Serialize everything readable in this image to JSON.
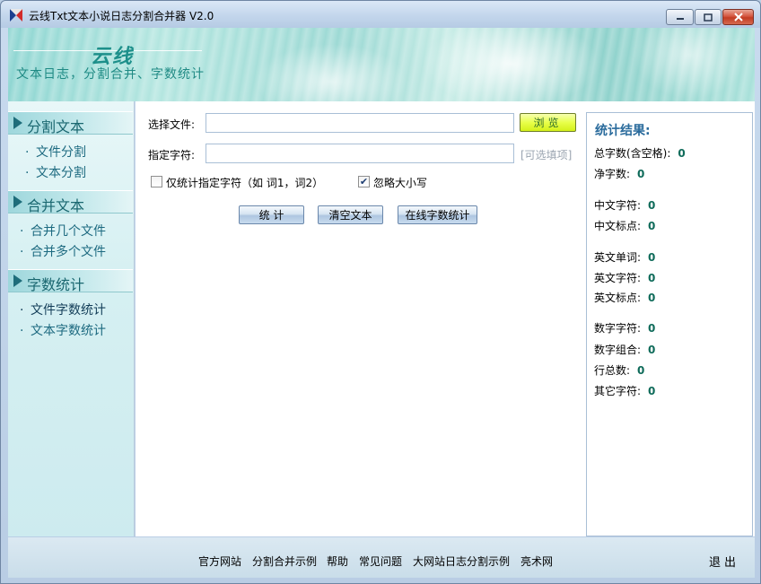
{
  "window": {
    "title": "云线Txt文本小说日志分割合并器 V2.0",
    "min_symbol": "▁",
    "max_symbol": "▢",
    "close_symbol": "✕"
  },
  "banner": {
    "brand": "云线",
    "slogan": "文本日志，分割合并、字数统计"
  },
  "sidebar": {
    "sections": [
      {
        "title": "分割文本",
        "items": [
          "文件分割",
          "文本分割"
        ]
      },
      {
        "title": "合并文本",
        "items": [
          "合并几个文件",
          "合并多个文件"
        ]
      },
      {
        "title": "字数统计",
        "items": [
          "文件字数统计",
          "文本字数统计"
        ]
      }
    ],
    "dot": "·"
  },
  "form": {
    "file_label": "选择文件:",
    "file_value": "",
    "browse_label": "浏览",
    "chars_label": "指定字符:",
    "chars_value": "",
    "chars_hint": "[可选填项]",
    "only_specified_label": "仅统计指定字符（如 词1，词2）",
    "only_specified_checked": false,
    "ignore_case_label": "忽略大小写",
    "ignore_case_checked": true,
    "check_mark": "✔",
    "btn_count": "统 计",
    "btn_clear": "清空文本",
    "btn_online": "在线字数统计"
  },
  "results": {
    "title": "统计结果:",
    "stats": [
      {
        "label": "总字数(含空格):",
        "value": "0"
      },
      {
        "label": "净字数:",
        "value": "0"
      },
      {
        "label": "中文字符:",
        "value": "0"
      },
      {
        "label": "中文标点:",
        "value": "0"
      },
      {
        "label": "英文单词:",
        "value": "0"
      },
      {
        "label": "英文字符:",
        "value": "0"
      },
      {
        "label": "英文标点:",
        "value": "0"
      },
      {
        "label": "数字字符:",
        "value": "0"
      },
      {
        "label": "数字组合:",
        "value": "0"
      },
      {
        "label": "行总数:",
        "value": "0"
      },
      {
        "label": "其它字符:",
        "value": "0"
      }
    ]
  },
  "footer": {
    "links": [
      "官方网站",
      "分割合并示例",
      "帮助",
      "常见问题",
      "大网站日志分割示例",
      "亮术网"
    ],
    "exit": "退出"
  },
  "colors": {
    "accent": "#1d8f8a",
    "sidebar_text": "#1d6a80",
    "result_value": "#0f6b5a",
    "browse_button": "#e8ff4a"
  }
}
